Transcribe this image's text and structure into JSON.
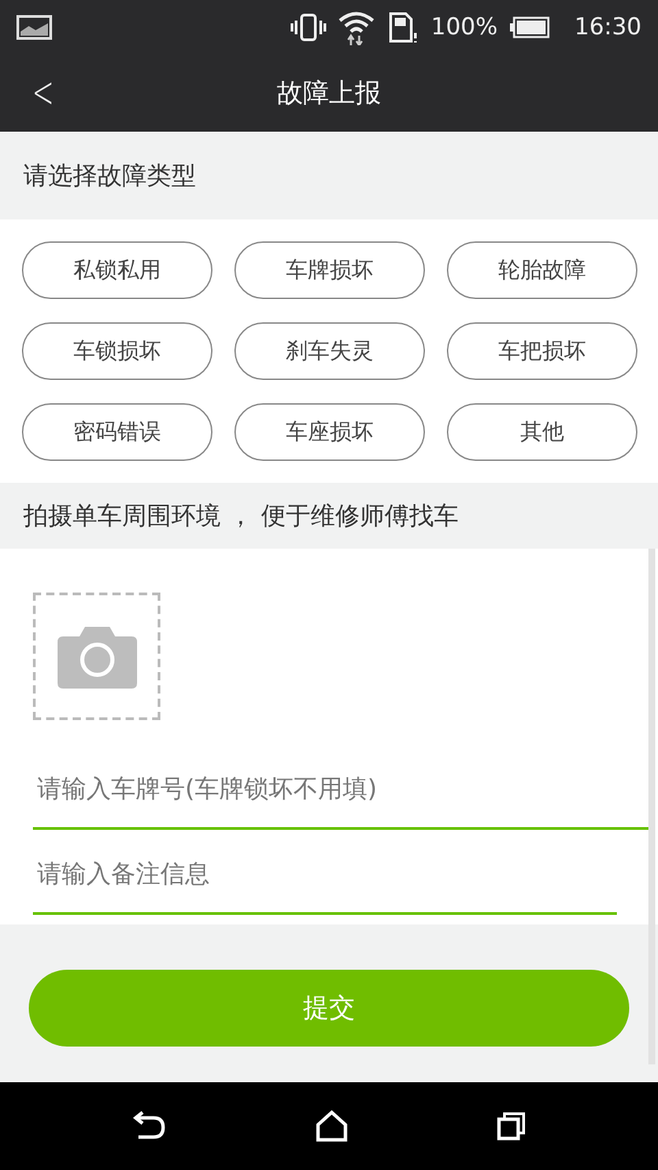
{
  "status_bar": {
    "battery": "100%",
    "time": "16:30"
  },
  "header": {
    "back": "<",
    "title": "故障上报"
  },
  "fault_section": {
    "heading": "请选择故障类型",
    "options": [
      {
        "label": "私锁私用"
      },
      {
        "label": "车牌损坏"
      },
      {
        "label": "轮胎故障"
      },
      {
        "label": "车锁损坏"
      },
      {
        "label": "刹车失灵"
      },
      {
        "label": "车把损坏"
      },
      {
        "label": "密码错误"
      },
      {
        "label": "车座损坏"
      },
      {
        "label": "其他"
      }
    ]
  },
  "photo_section": {
    "heading": "拍摄单车周围环境 ， 便于维修师傅找车"
  },
  "fields": [
    {
      "placeholder": "请输入车牌号(车牌锁坏不用填)"
    },
    {
      "placeholder": "请输入备注信息"
    }
  ],
  "submit": "提交"
}
